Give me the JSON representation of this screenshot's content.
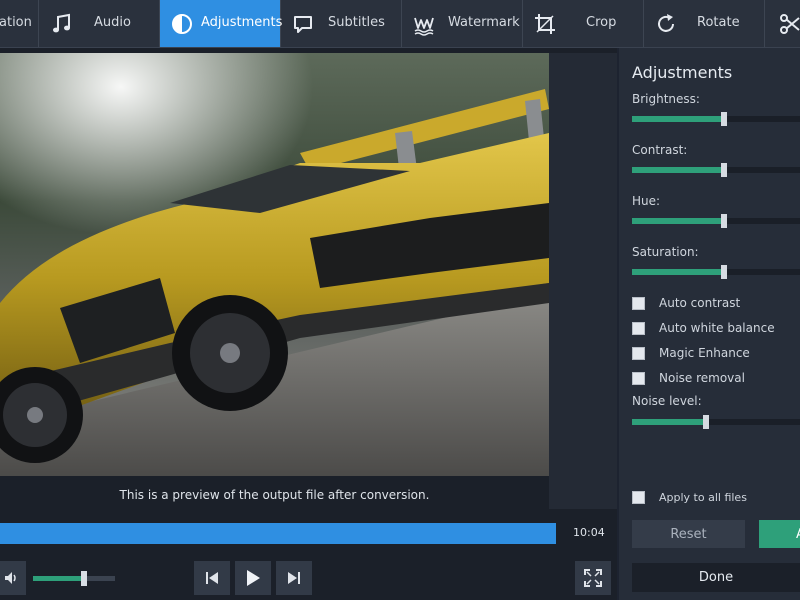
{
  "toolbar": {
    "tabs": [
      {
        "label": "ation",
        "icon": "rotation-icon"
      },
      {
        "label": "Audio",
        "icon": "music-note-icon"
      },
      {
        "label": "Adjustments",
        "icon": "adjustments-icon",
        "active": true
      },
      {
        "label": "Subtitles",
        "icon": "speech-bubble-icon"
      },
      {
        "label": "Watermark",
        "icon": "watermark-icon"
      },
      {
        "label": "Crop",
        "icon": "crop-icon"
      },
      {
        "label": "Rotate",
        "icon": "rotate-icon"
      },
      {
        "label": "",
        "icon": "scissors-icon"
      }
    ]
  },
  "preview": {
    "caption": "This is a preview of the output file after conversion.",
    "time": "10:04",
    "progress_fraction": 1.0,
    "volume_fraction": 0.62
  },
  "adjustments": {
    "title": "Adjustments",
    "sliders": [
      {
        "label": "Brightness:",
        "fraction": 0.55
      },
      {
        "label": "Contrast:",
        "fraction": 0.55
      },
      {
        "label": "Hue:",
        "fraction": 0.55
      },
      {
        "label": "Saturation:",
        "fraction": 0.55
      }
    ],
    "checkboxes": [
      {
        "label": "Auto contrast",
        "checked": false
      },
      {
        "label": "Auto white balance",
        "checked": false
      },
      {
        "label": "Magic Enhance",
        "checked": false
      },
      {
        "label": "Noise removal",
        "checked": false
      }
    ],
    "noise_level": {
      "label": "Noise level:",
      "fraction": 0.44
    },
    "apply_all": {
      "label": "Apply to all files",
      "checked": false
    },
    "reset_label": "Reset",
    "apply_label": "A",
    "done_label": "Done"
  },
  "colors": {
    "accent": "#2f8fe2",
    "slider_fill": "#2ea07a",
    "apply_button": "#2ea07a"
  }
}
